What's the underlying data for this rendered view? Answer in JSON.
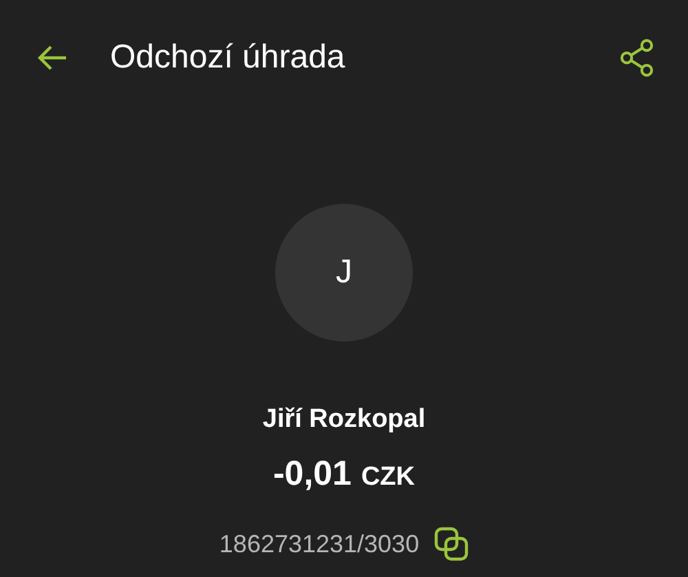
{
  "header": {
    "title": "Odchozí úhrada"
  },
  "payee": {
    "initial": "J",
    "name": "Jiří Rozkopal",
    "amount": "-0,01",
    "currency": "CZK",
    "account": "1862731231/3030"
  }
}
